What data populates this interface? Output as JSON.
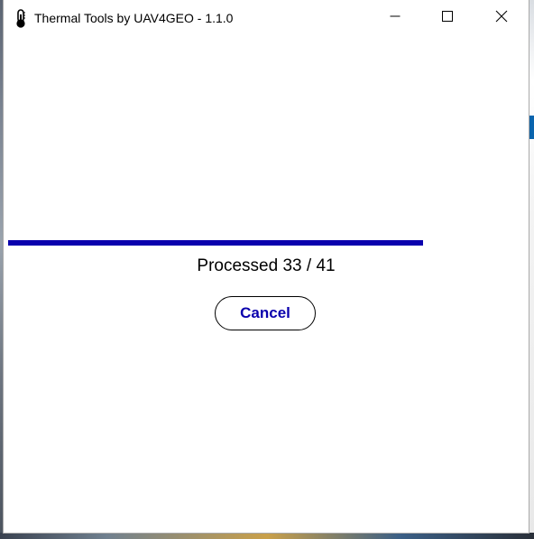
{
  "window": {
    "title": "Thermal Tools by UAV4GEO - 1.1.0",
    "icons": {
      "app": "thermometer-icon",
      "minimize": "minimize-icon",
      "maximize": "maximize-icon",
      "close": "close-icon"
    }
  },
  "progress": {
    "processed": 33,
    "total": 41,
    "fraction": 0.805,
    "status_text": "Processed 33 / 41",
    "color": "#0a00ad"
  },
  "actions": {
    "cancel_label": "Cancel"
  }
}
